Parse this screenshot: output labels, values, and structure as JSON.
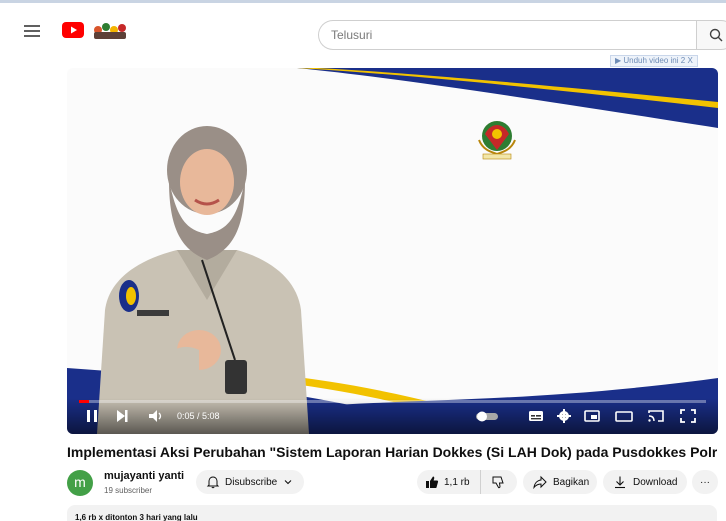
{
  "header": {
    "search_placeholder": "Telusuri"
  },
  "ad": {
    "label": "▶ Unduh video ini",
    "close": "2 X"
  },
  "player": {
    "time": "0:05 / 5:08",
    "progress_fraction": 0.016
  },
  "video": {
    "title": "Implementasi Aksi Perubahan \"Sistem Laporan Harian Dokkes (Si LAH Dok) pada Pusdokkes Polri\""
  },
  "channel": {
    "avatar_letter": "m",
    "name": "mujayanti yanti",
    "subscribers": "19 subscriber"
  },
  "actions": {
    "subscribe_label": "Disubscribe",
    "like_count": "1,1 rb",
    "share_label": "Bagikan",
    "download_label": "Download",
    "more_label": "···"
  },
  "description": {
    "stats": "1,6 rb x ditonton  3 hari yang lalu"
  },
  "colors": {
    "brand_red": "#ff0000",
    "slide_navy": "#1a2f8a",
    "slide_gold": "#f2c200",
    "avatar_green": "#43a047"
  }
}
